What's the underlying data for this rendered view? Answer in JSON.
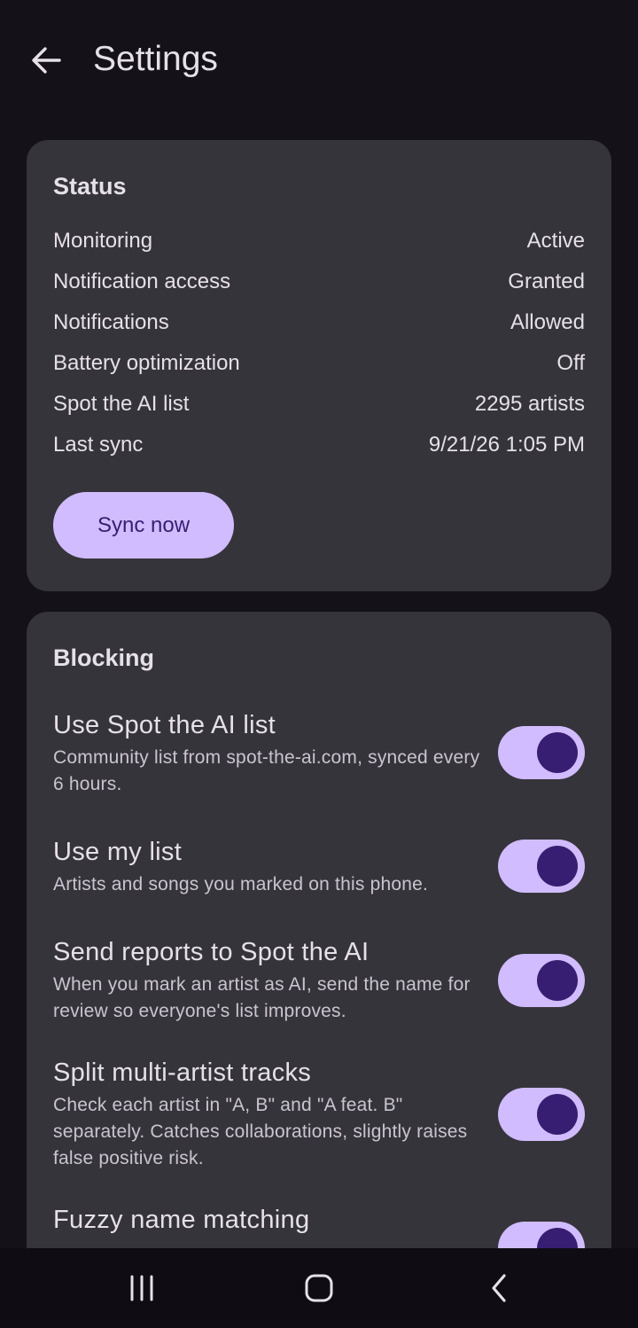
{
  "header": {
    "title": "Settings"
  },
  "status": {
    "title": "Status",
    "rows": [
      {
        "label": "Monitoring",
        "value": "Active"
      },
      {
        "label": "Notification access",
        "value": "Granted"
      },
      {
        "label": "Notifications",
        "value": "Allowed"
      },
      {
        "label": "Battery optimization",
        "value": "Off"
      },
      {
        "label": "Spot the AI list",
        "value": "2295 artists"
      },
      {
        "label": "Last sync",
        "value": "9/21/26 1:05 PM"
      }
    ],
    "sync_button": "Sync now"
  },
  "blocking": {
    "title": "Blocking",
    "settings": [
      {
        "title": "Use Spot the AI list",
        "desc": "Community list from spot-the-ai.com, synced every 6 hours.",
        "on": true
      },
      {
        "title": "Use my list",
        "desc": "Artists and songs you marked on this phone.",
        "on": true
      },
      {
        "title": "Send reports to Spot the AI",
        "desc": "When you mark an artist as AI, send the name for review so everyone's list improves.",
        "on": true
      },
      {
        "title": "Split multi-artist tracks",
        "desc": "Check each artist in \"A, B\" and \"A feat. B\" separately. Catches collaborations, slightly raises false positive risk.",
        "on": true
      },
      {
        "title": "Fuzzy name matching",
        "desc": "",
        "on": true
      }
    ]
  },
  "colors": {
    "background": "#141218",
    "card": "#36343b",
    "accent": "#d0bcff",
    "accent_dark": "#381e72"
  },
  "icons": {
    "back": "arrow-back-icon",
    "recents": "recents-icon",
    "home": "home-icon",
    "nav_back": "nav-back-icon"
  }
}
